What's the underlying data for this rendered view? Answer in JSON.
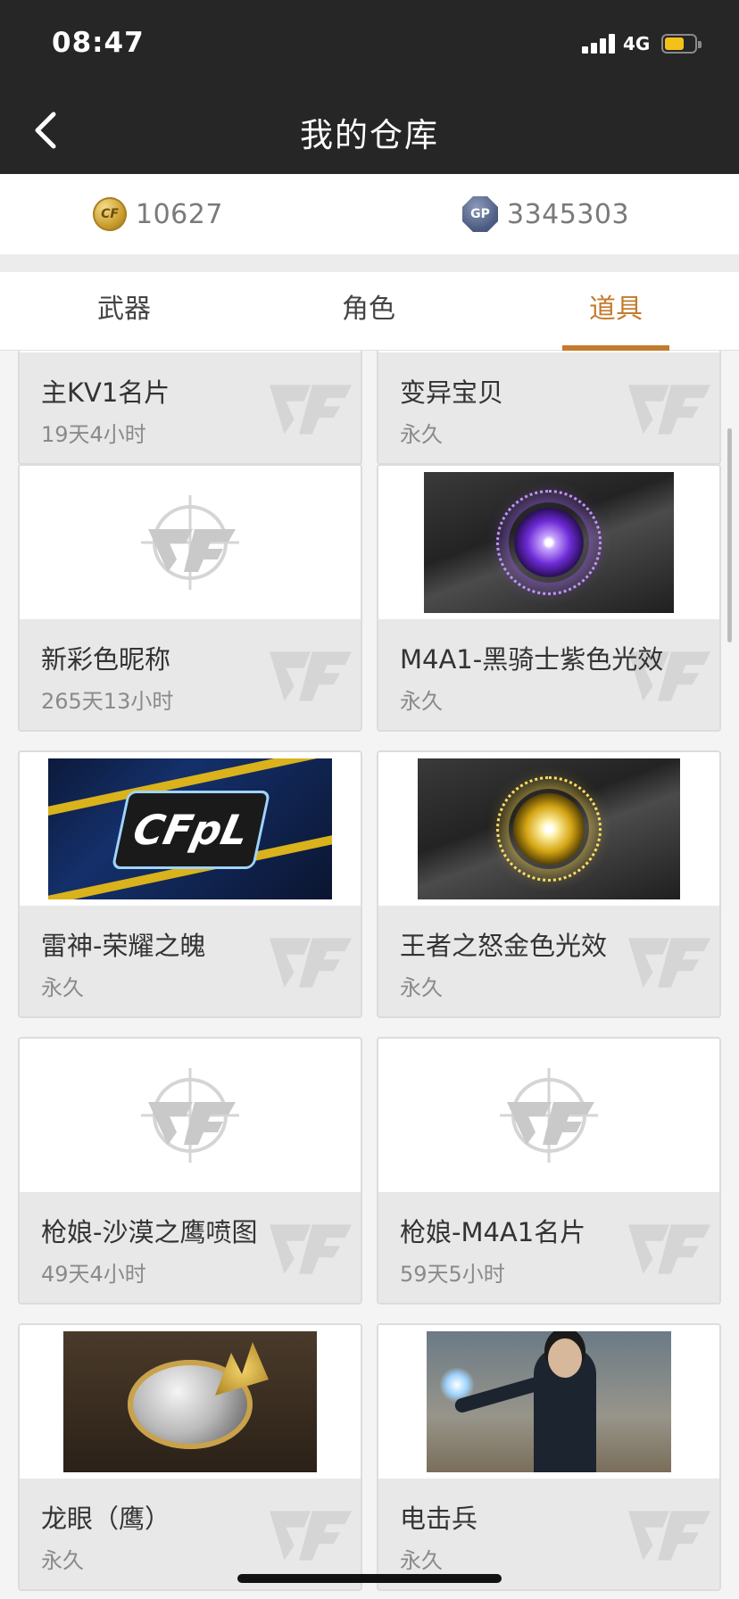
{
  "status_bar": {
    "time": "08:47",
    "network": "4G",
    "battery_level": 0.65,
    "battery_color": "#f2c21b"
  },
  "nav": {
    "title": "我的仓库",
    "back_icon": "chevron-left-icon"
  },
  "currency": {
    "cf_points": "10627",
    "gp_points": "3345303",
    "cf_icon": "cf-coin-icon",
    "gp_icon": "gp-coin-icon",
    "gp_icon_label": "GP"
  },
  "tabs": [
    {
      "label": "武器",
      "active": false
    },
    {
      "label": "角色",
      "active": false
    },
    {
      "label": "道具",
      "active": true
    }
  ],
  "accent_color": "#c47a2c",
  "items": [
    {
      "name": "主KV1名片",
      "duration": "19天4小时",
      "image": "partial"
    },
    {
      "name": "变异宝贝",
      "duration": "永久",
      "image": "partial"
    },
    {
      "name": "新彩色昵称",
      "duration": "265天13小时",
      "image": "placeholder"
    },
    {
      "name": "M4A1-黑骑士紫色光效",
      "duration": "永久",
      "image": "purple-glow"
    },
    {
      "name": "雷神-荣耀之魄",
      "duration": "永久",
      "image": "cfpl-banner"
    },
    {
      "name": "王者之怒金色光效",
      "duration": "永久",
      "image": "gold-glow"
    },
    {
      "name": "枪娘-沙漠之鹰喷图",
      "duration": "49天4小时",
      "image": "placeholder"
    },
    {
      "name": "枪娘-M4A1名片",
      "duration": "59天5小时",
      "image": "placeholder"
    },
    {
      "name": "龙眼（鹰）",
      "duration": "永久",
      "image": "dragon-ring"
    },
    {
      "name": "电击兵",
      "duration": "永久",
      "image": "soldier"
    }
  ],
  "banner_text": "CFpL"
}
